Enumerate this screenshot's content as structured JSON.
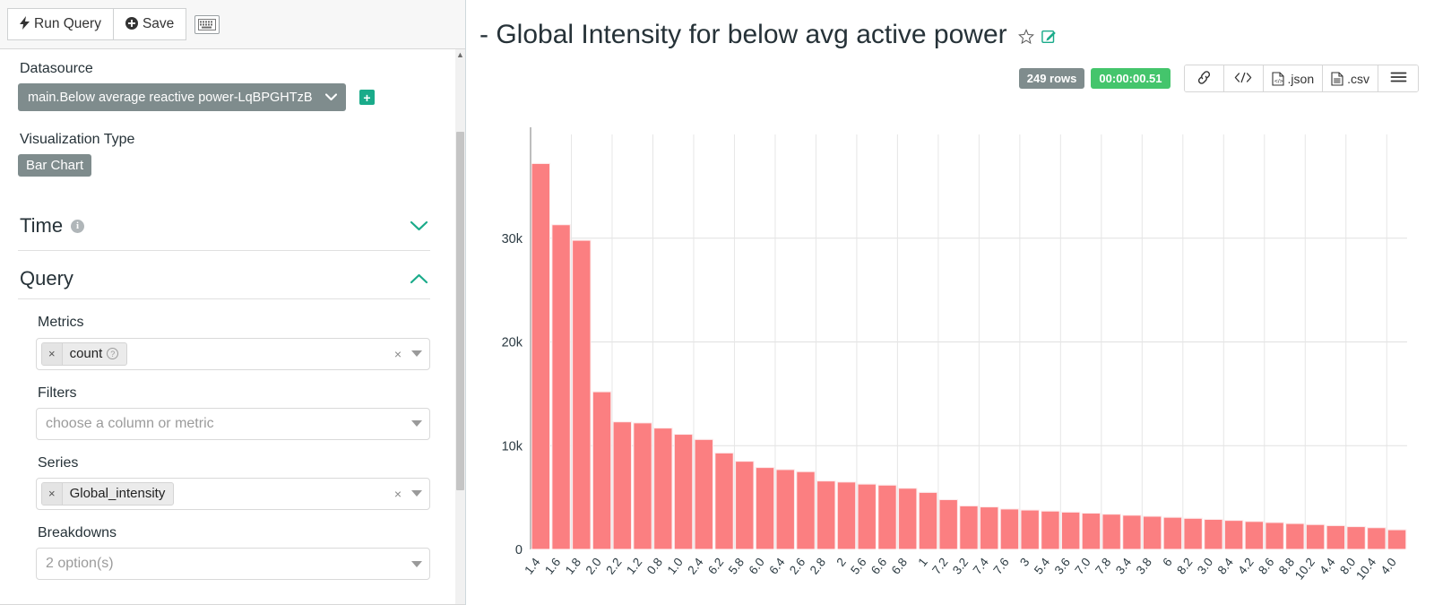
{
  "toolbar": {
    "run_query_label": "Run Query",
    "save_label": "Save",
    "run_icon": "bolt-icon",
    "save_icon": "circle-plus-icon",
    "keyboard_icon": "keyboard-icon"
  },
  "controls": {
    "datasource": {
      "label": "Datasource",
      "value": "main.Below average reactive power-LqBPGHTzB",
      "add_label": "+"
    },
    "viz_type": {
      "label": "Visualization Type",
      "value": "Bar Chart"
    },
    "sections": [
      {
        "title": "Time",
        "expanded": false,
        "has_info": true,
        "chevron": "∨"
      },
      {
        "title": "Query",
        "expanded": true,
        "has_info": false,
        "chevron": "∧"
      }
    ],
    "metrics": {
      "label": "Metrics",
      "tokens": [
        "count"
      ],
      "token_help": "?",
      "clear": "×",
      "remove": "×"
    },
    "filters": {
      "label": "Filters",
      "placeholder": "choose a column or metric",
      "value": ""
    },
    "series": {
      "label": "Series",
      "tokens": [
        "Global_intensity"
      ],
      "clear": "×",
      "remove": "×"
    },
    "breakdowns": {
      "label": "Breakdowns",
      "placeholder": "2 option(s)",
      "value": ""
    }
  },
  "chart": {
    "title": "- Global Intensity for below avg active power",
    "favorite_icon": "star-icon",
    "edit_icon": "edit-properties-icon",
    "rows_badge": "249 rows",
    "time_badge": "00:00:00.51",
    "buttons": [
      {
        "name": "share-link-button",
        "label": "",
        "icon": "link-icon"
      },
      {
        "name": "view-query-button",
        "label": "",
        "icon": "code-icon"
      },
      {
        "name": "export-json-button",
        "label": ".json",
        "icon": "json-file-icon"
      },
      {
        "name": "export-csv-button",
        "label": ".csv",
        "icon": "csv-file-icon"
      },
      {
        "name": "more-menu-button",
        "label": "",
        "icon": "hamburger-icon"
      }
    ]
  },
  "chart_data": {
    "type": "bar",
    "title": "- Global Intensity for below avg active power",
    "xlabel": "",
    "ylabel": "",
    "ylim": [
      0,
      40000
    ],
    "yticks": [
      0,
      10000,
      20000,
      30000
    ],
    "ytick_labels": [
      "0",
      "10k",
      "20k",
      "30k"
    ],
    "grid": true,
    "legend": false,
    "bar_color": "#fb7f81",
    "series_name": "count",
    "categories": [
      "1.4",
      "1.6",
      "1.8",
      "2.0",
      "2.2",
      "1.2",
      "0.8",
      "1.0",
      "2.4",
      "6.2",
      "5.8",
      "6.0",
      "6.4",
      "2.6",
      "2.8",
      "2",
      "5.6",
      "6.6",
      "6.8",
      "1",
      "7.2",
      "3.2",
      "7.4",
      "7.6",
      "3",
      "5.4",
      "3.6",
      "7.0",
      "7.8",
      "3.4",
      "3.8",
      "6",
      "8.2",
      "3.0",
      "8.4",
      "4.2",
      "8.6",
      "8.8",
      "10.2",
      "4.4",
      "8.0",
      "10.4",
      "4.0"
    ],
    "values": [
      37200,
      31300,
      29800,
      15200,
      12300,
      12200,
      11700,
      11100,
      10600,
      9300,
      8500,
      7900,
      7700,
      7500,
      6600,
      6500,
      6300,
      6200,
      5900,
      5500,
      4800,
      4200,
      4100,
      3900,
      3800,
      3700,
      3600,
      3500,
      3400,
      3300,
      3200,
      3100,
      3000,
      2900,
      2800,
      2700,
      2600,
      2500,
      2400,
      2300,
      2200,
      2100,
      1900
    ]
  }
}
